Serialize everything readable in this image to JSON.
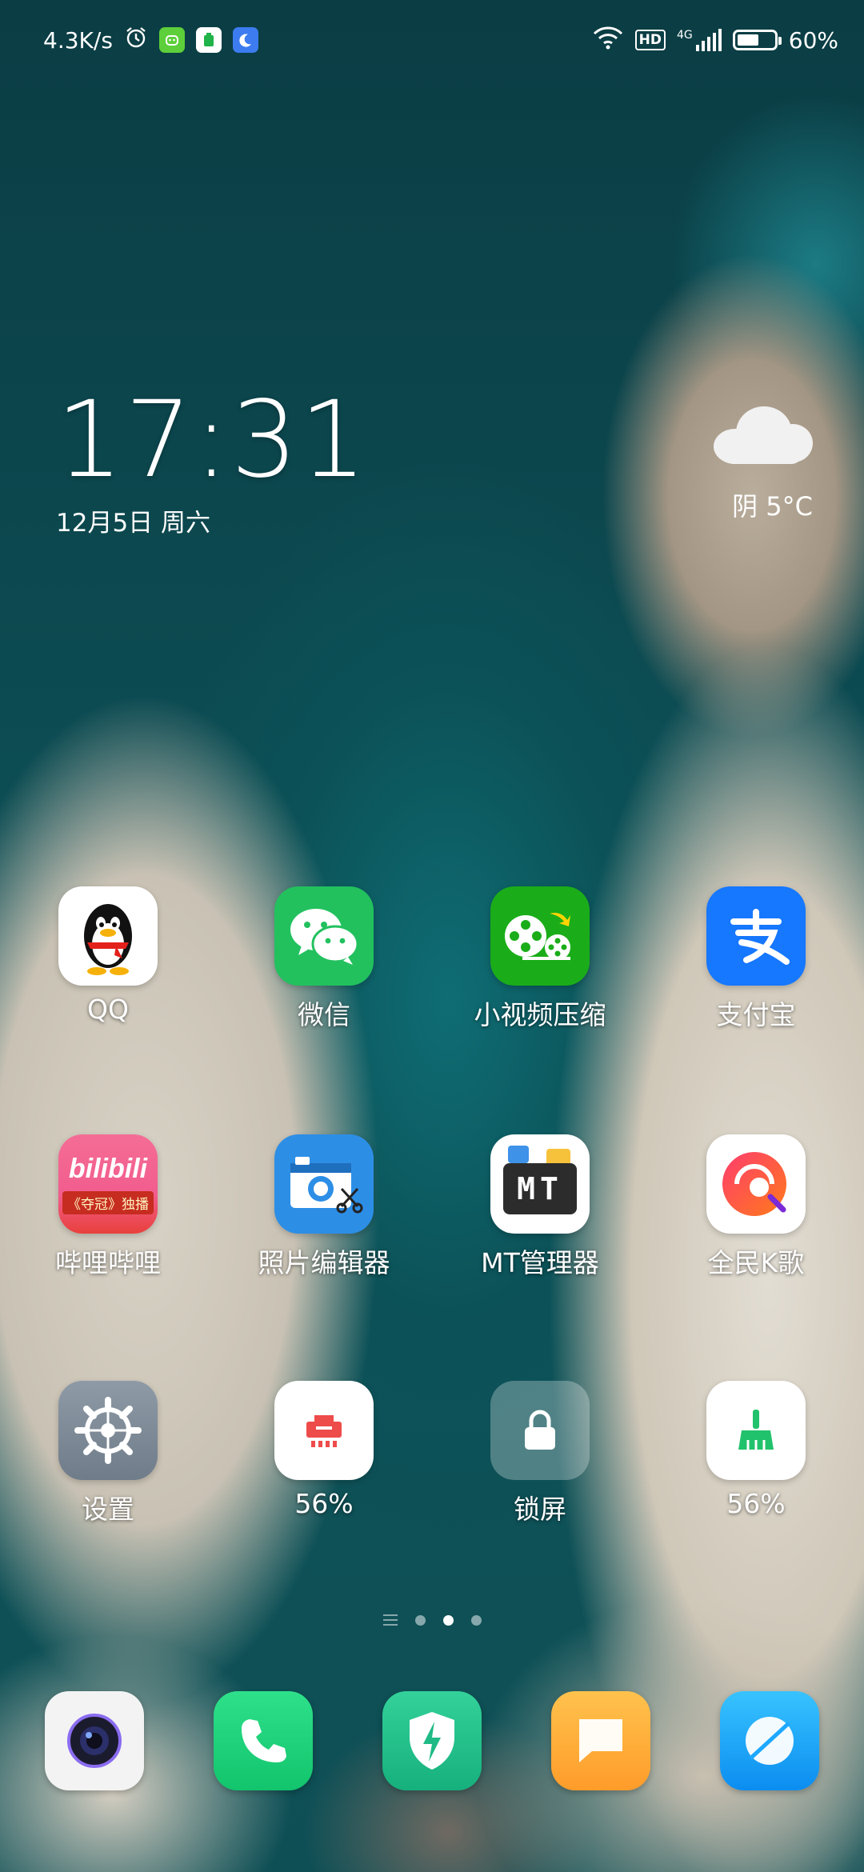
{
  "status_bar": {
    "net_speed": "4.3K/s",
    "network_type": "4G",
    "hd_label": "HD",
    "battery": "60%",
    "battery_level": 0.6,
    "icons": [
      "alarm-icon",
      "android-app-icon",
      "cleaner-app-icon",
      "moon-app-icon",
      "wifi-icon",
      "hd-icon",
      "signal-icon",
      "battery-icon"
    ]
  },
  "clock": {
    "time": "17:31",
    "date": "12月5日 周六"
  },
  "weather": {
    "text": "阴 5°C",
    "icon": "cloud-icon"
  },
  "apps": [
    {
      "label": "QQ",
      "icon": "qq-penguin-icon",
      "color": "#ffffff"
    },
    {
      "label": "微信",
      "icon": "wechat-icon",
      "color": "#22c15e"
    },
    {
      "label": "小视频压缩",
      "icon": "film-reel-icon",
      "color": "#1aad19"
    },
    {
      "label": "支付宝",
      "icon": "alipay-icon",
      "color": "#1677ff"
    },
    {
      "label": "哔哩哔哩",
      "icon": "bilibili-icon",
      "color": "#f25d8e",
      "icon_text": "bilibili",
      "icon_subtext": "《夺冠》独播"
    },
    {
      "label": "照片编辑器",
      "icon": "camera-scissors-icon",
      "color": "#2d8ee6"
    },
    {
      "label": "MT管理器",
      "icon": "mt-icon",
      "color": "#ffffff",
      "icon_text": "MT"
    },
    {
      "label": "全民K歌",
      "icon": "karaoke-icon",
      "color": "#ffffff"
    },
    {
      "label": "设置",
      "icon": "gear-icon",
      "color": "#7d8a96"
    },
    {
      "label": "56%",
      "icon": "speedup-icon",
      "color": "#ffffff"
    },
    {
      "label": "锁屏",
      "icon": "lock-icon",
      "color": "rgba(255,255,255,0.25)"
    },
    {
      "label": "56%",
      "icon": "broom-icon",
      "color": "#ffffff"
    }
  ],
  "page_indicator": {
    "pages": 3,
    "active": 2
  },
  "dock": [
    {
      "name": "camera",
      "icon": "camera-icon",
      "color": "#f3f3f3"
    },
    {
      "name": "phone",
      "icon": "phone-icon",
      "color": "#1fd27a"
    },
    {
      "name": "security",
      "icon": "shield-bolt-icon",
      "color": "#23c08a"
    },
    {
      "name": "messages",
      "icon": "message-icon",
      "color": "#ffb43a"
    },
    {
      "name": "browser",
      "icon": "browser-icon",
      "color": "#1ea8ff"
    }
  ]
}
